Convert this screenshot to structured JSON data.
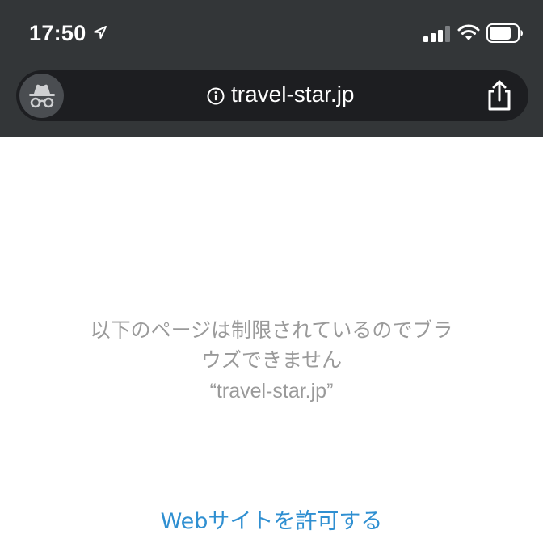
{
  "status_bar": {
    "time": "17:50",
    "icons": [
      "location-arrow-icon",
      "cellular-signal-icon",
      "wifi-icon",
      "battery-icon"
    ]
  },
  "toolbar": {
    "url": "travel-star.jp",
    "icons": [
      "incognito-icon",
      "info-icon",
      "share-icon"
    ]
  },
  "message": {
    "line1": "以下のページは制限されているのでブラ",
    "line2": "ウズできません",
    "domain": "“travel-star.jp”"
  },
  "allow_link": "Webサイトを許可する",
  "colors": {
    "chrome_bar": "#333638",
    "url_field": "#1d1e21",
    "message_text": "#9a9a9a",
    "link": "#2f8fd1"
  }
}
